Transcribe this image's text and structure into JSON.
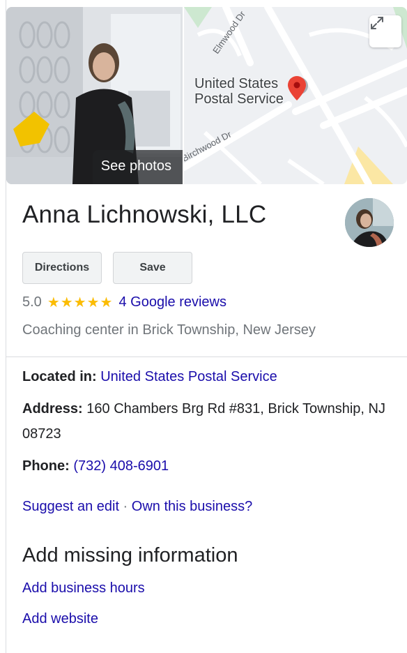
{
  "header": {
    "see_photos_label": "See photos",
    "map_place_label_line1": "United States",
    "map_place_label_line2": "Postal Service",
    "street_elmwood": "Elmwood Dr",
    "street_birchwood": "Birchwood Dr",
    "expand_icon": "expand-map-icon",
    "pin_color": "#ea4335"
  },
  "business": {
    "name": "Anna Lichnowski, LLC",
    "rating": "5.0",
    "stars": "★★★★★",
    "reviews_link": "4 Google reviews",
    "category": "Coaching center in Brick Township, New Jersey"
  },
  "actions": {
    "directions_label": "Directions",
    "save_label": "Save"
  },
  "details": {
    "located_in_label": "Located in:",
    "located_in_value": "United States Postal Service",
    "address_label": "Address:",
    "address_value": "160 Chambers Brg Rd #831, Brick Township, NJ 08723",
    "phone_label": "Phone:",
    "phone_value": "(732) 408-6901"
  },
  "edit_links": {
    "suggest_edit": "Suggest an edit",
    "separator": " · ",
    "own_business": "Own this business?"
  },
  "missing_info": {
    "title": "Add missing information",
    "hours_link": "Add business hours",
    "website_link": "Add website"
  },
  "colors": {
    "link": "#1a0dab",
    "star": "#fbbc04",
    "muted_text": "#70757a"
  }
}
